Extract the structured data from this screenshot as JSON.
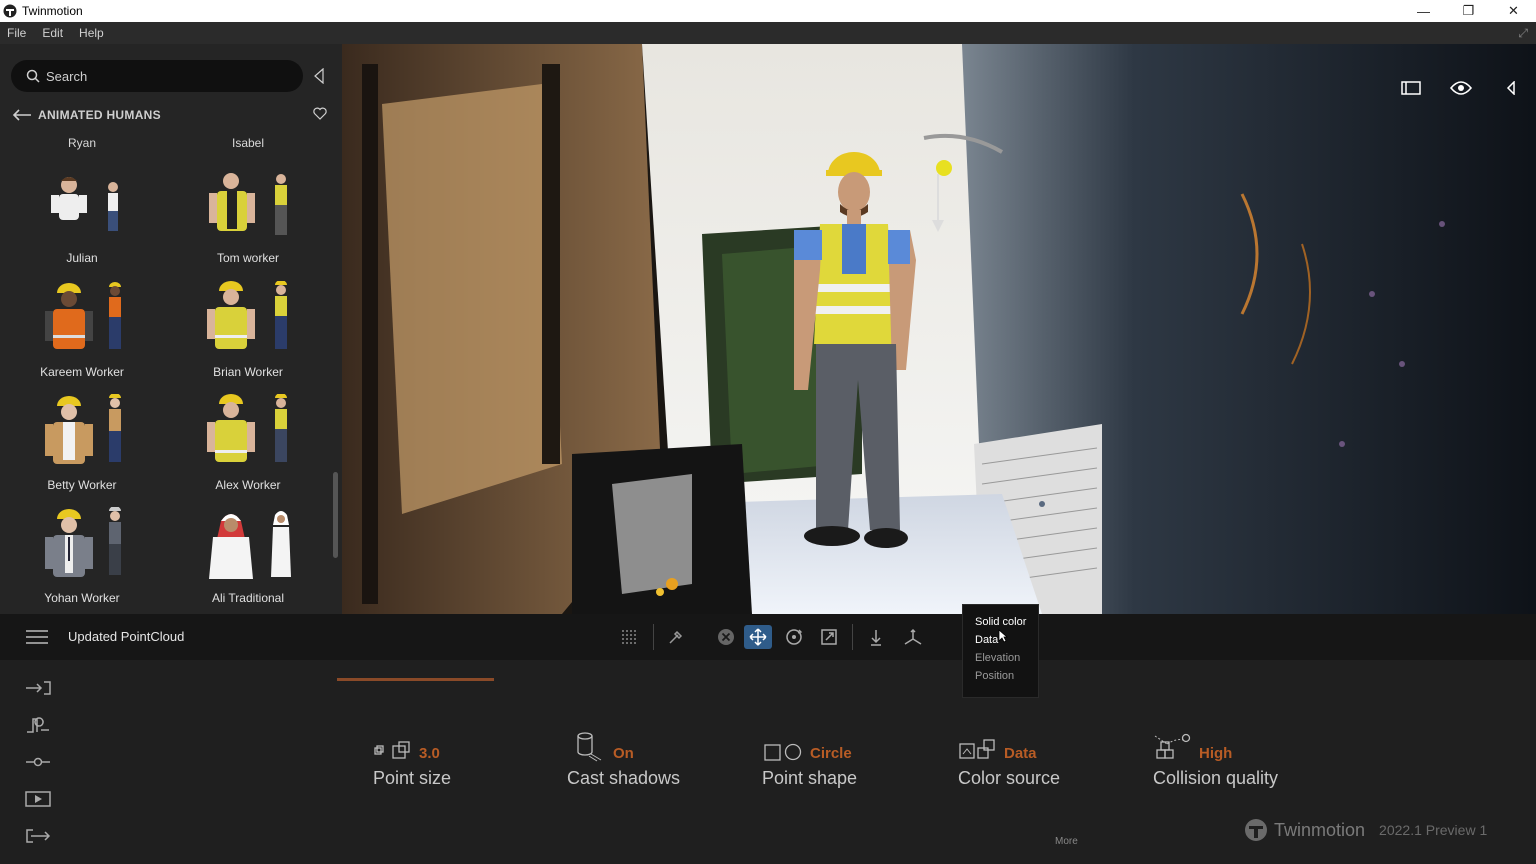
{
  "window": {
    "title": "Twinmotion",
    "minimize": "—",
    "restore": "❐",
    "close": "✕"
  },
  "menu": [
    "File",
    "Edit",
    "Help"
  ],
  "library": {
    "search_placeholder": "Search",
    "category": "ANIMATED HUMANS",
    "partial_names": [
      "Ryan",
      "Isabel"
    ],
    "items": [
      {
        "name": "Julian"
      },
      {
        "name": "Tom worker"
      },
      {
        "name": "Kareem Worker"
      },
      {
        "name": "Brian Worker"
      },
      {
        "name": "Betty Worker"
      },
      {
        "name": "Alex Worker"
      },
      {
        "name": "Yohan Worker"
      },
      {
        "name": "Ali Traditional"
      }
    ]
  },
  "scene": {
    "name": "Updated PointCloud"
  },
  "color_source_menu": {
    "options": [
      "Solid color",
      "Data",
      "Elevation",
      "Position"
    ],
    "hovered": "Data"
  },
  "properties": [
    {
      "label": "Point size",
      "value": "3.0",
      "icon": "point-size-icon"
    },
    {
      "label": "Cast shadows",
      "value": "On",
      "icon": "cylinder-icon"
    },
    {
      "label": "Point shape",
      "value": "Circle",
      "icon": "shape-icon"
    },
    {
      "label": "Color source",
      "value": "Data",
      "icon": "color-source-icon"
    },
    {
      "label": "Collision quality",
      "value": "High",
      "icon": "collision-icon"
    }
  ],
  "more_label": "More",
  "brand": {
    "name": "Twinmotion",
    "version": "2022.1 Preview 1"
  },
  "colors": {
    "accent": "#b85c25",
    "active_tool": "#2f5c8a",
    "worker_vest": "#d9d13a",
    "hardhat": "#e8c820"
  }
}
